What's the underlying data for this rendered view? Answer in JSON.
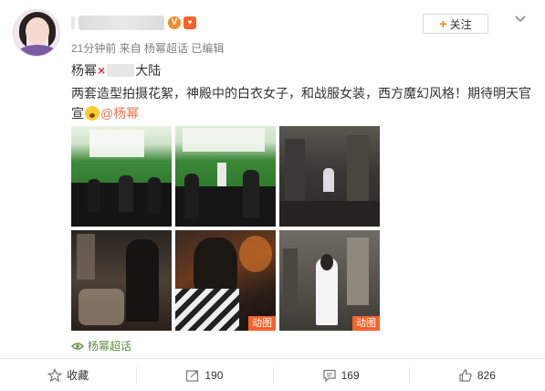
{
  "post": {
    "meta": "21分钟前 来自 杨幂超话 已编辑",
    "follow_label": "关注",
    "follow_plus": "+",
    "line1_a": "杨幂",
    "line1_x": "×",
    "line1_b": "大陆",
    "line2_text": "两套造型拍摄花絮，神殿中的白衣女子，和战服女装，西方魔幻风格！期待明天官宣",
    "mention": "@杨幂",
    "photo_tags": [
      "动图",
      "动图"
    ],
    "super_topic": "杨幂超话"
  },
  "actions": {
    "collect": "收藏",
    "repost": "190",
    "comment": "169",
    "like": "826"
  },
  "colors": {
    "accent": "#ff8200",
    "mention": "#eb7350",
    "topic": "#5f8b46",
    "tag": "#f5622b"
  }
}
